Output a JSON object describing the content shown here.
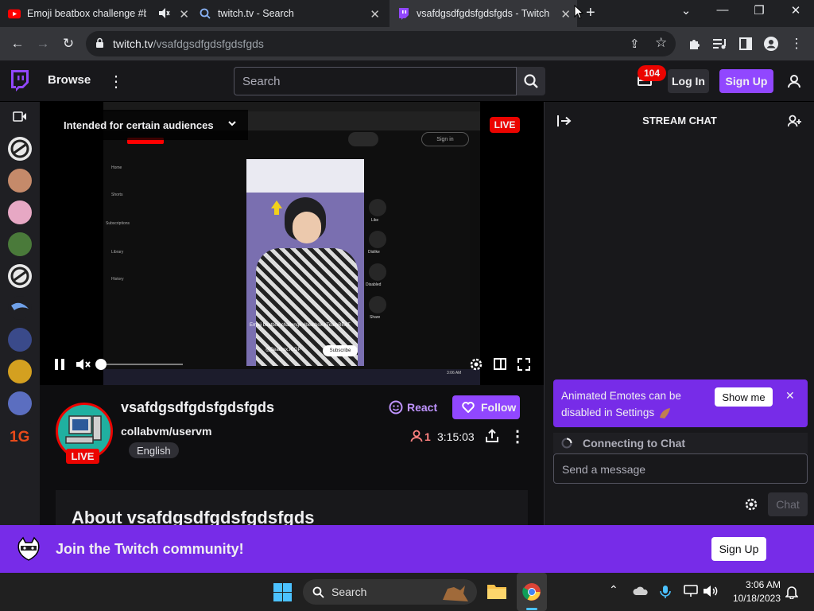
{
  "browser": {
    "tabs": [
      {
        "title": "Emoji beatbox challenge #b",
        "active": false
      },
      {
        "title": "twitch.tv - Search",
        "active": false
      },
      {
        "title": "vsafdgsdfgdsfgdsfgds - Twitch",
        "active": true
      }
    ],
    "url_host": "twitch.tv",
    "url_path": "/vsafdgsdfgdsfgdsfgds"
  },
  "twitch_nav": {
    "browse": "Browse",
    "search_placeholder": "Search",
    "notification_count": "104",
    "login": "Log In",
    "signup": "Sign Up"
  },
  "player": {
    "content_warning": "Intended for certain audiences",
    "live_badge": "LIVE",
    "inner": {
      "yt_sidebar": [
        "Home",
        "Shorts",
        "Subscriptions",
        "Library",
        "History"
      ],
      "yt_actions": [
        "Like",
        "Dislike",
        "Disabled",
        "Share"
      ],
      "caption": "Emoji beatbox challenge #beatbox #TeamBEAT",
      "channel": "@Beatbox.ICOP",
      "subscribe": "Subscribe",
      "tray_time": "3:06 AM"
    }
  },
  "channel": {
    "name": "vsafdgsdfgdsfgdsfgds",
    "category": "collabvm/uservm",
    "language": "English",
    "live": "LIVE",
    "react": "React",
    "follow": "Follow",
    "viewers": "1",
    "uptime": "3:15:03",
    "about_title": "About vsafdgsdfgdsfgdsfgds"
  },
  "chat": {
    "header": "STREAM CHAT",
    "notice": "Animated Emotes can be disabled in Settings",
    "show_me": "Show me",
    "connecting": "Connecting to Chat",
    "placeholder": "Send a message",
    "chat_button": "Chat"
  },
  "banner": {
    "text": "Join the Twitch community!",
    "signup": "Sign Up"
  },
  "taskbar": {
    "search": "Search",
    "time": "3:06 AM",
    "date": "10/18/2023"
  },
  "colors": {
    "twitch_purple": "#9147ff",
    "live_red": "#eb0400",
    "banner": "#772ce8"
  }
}
